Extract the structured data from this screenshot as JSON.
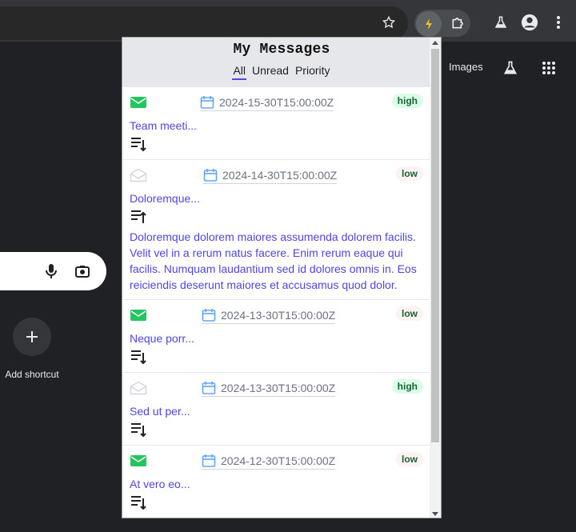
{
  "ntp": {
    "images_link": "Images",
    "shortcut_label": "Add shortcut"
  },
  "popup": {
    "title": "My Messages",
    "tabs": [
      {
        "label": "All",
        "active": true
      },
      {
        "label": "Unread",
        "active": false
      },
      {
        "label": "Priority",
        "active": false
      }
    ],
    "messages": [
      {
        "read": false,
        "date": "2024-15-30T15:00:00Z",
        "priority": "high",
        "subject": "Team meeti...",
        "expanded": false,
        "body": ""
      },
      {
        "read": true,
        "date": "2024-14-30T15:00:00Z",
        "priority": "low",
        "subject": "Doloremque...",
        "expanded": true,
        "body": "Doloremque dolorem maiores assumenda dolorem facilis. Velit vel in a rerum natus facere. Enim rerum eaque qui facilis. Numquam laudantium sed id dolores omnis in. Eos reiciendis deserunt maiores et accusamus quod dolor."
      },
      {
        "read": false,
        "date": "2024-13-30T15:00:00Z",
        "priority": "low",
        "subject": "Neque porr...",
        "expanded": false,
        "body": ""
      },
      {
        "read": true,
        "date": "2024-13-30T15:00:00Z",
        "priority": "high",
        "subject": "Sed ut per...",
        "expanded": false,
        "body": ""
      },
      {
        "read": false,
        "date": "2024-12-30T15:00:00Z",
        "priority": "low",
        "subject": "At vero eo...",
        "expanded": false,
        "body": ""
      }
    ]
  },
  "colors": {
    "accent": "#4f46e5",
    "unread_envelope": "#22c55e",
    "calendar": "#60a5fa"
  }
}
